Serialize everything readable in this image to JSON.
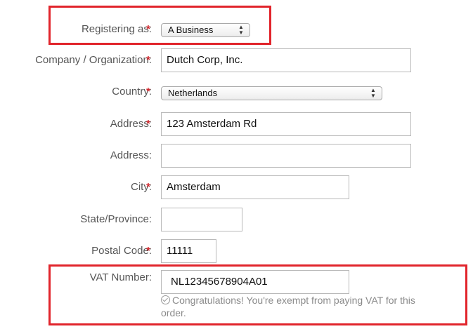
{
  "form": {
    "registering_as": {
      "label": "Registering as:",
      "value": "A Business",
      "required": "*"
    },
    "company": {
      "label": "Company / Organization:",
      "value": "Dutch Corp, Inc.",
      "required": "*"
    },
    "country": {
      "label": "Country:",
      "value": "Netherlands",
      "required": "*"
    },
    "address1": {
      "label": "Address:",
      "value": "123 Amsterdam Rd",
      "required": "*"
    },
    "address2": {
      "label": "Address:",
      "value": ""
    },
    "city": {
      "label": "City:",
      "value": "Amsterdam",
      "required": "*"
    },
    "state": {
      "label": "State/Province:",
      "value": ""
    },
    "postal_code": {
      "label": "Postal Code:",
      "value": "11111",
      "required": "*"
    },
    "vat": {
      "label": "VAT Number:",
      "value": "NL12345678904A01",
      "notice_line1": "Congratulations! You're exempt from paying VAT for this",
      "notice_line2": "order."
    }
  },
  "colors": {
    "highlight": "#e1242b",
    "required_star": "#d0272d",
    "label_text": "#555555",
    "notice_text": "#8a8a8a"
  },
  "icons": {
    "select_arrows": "up-down-chevron-icon",
    "notice": "check-circle-icon"
  }
}
